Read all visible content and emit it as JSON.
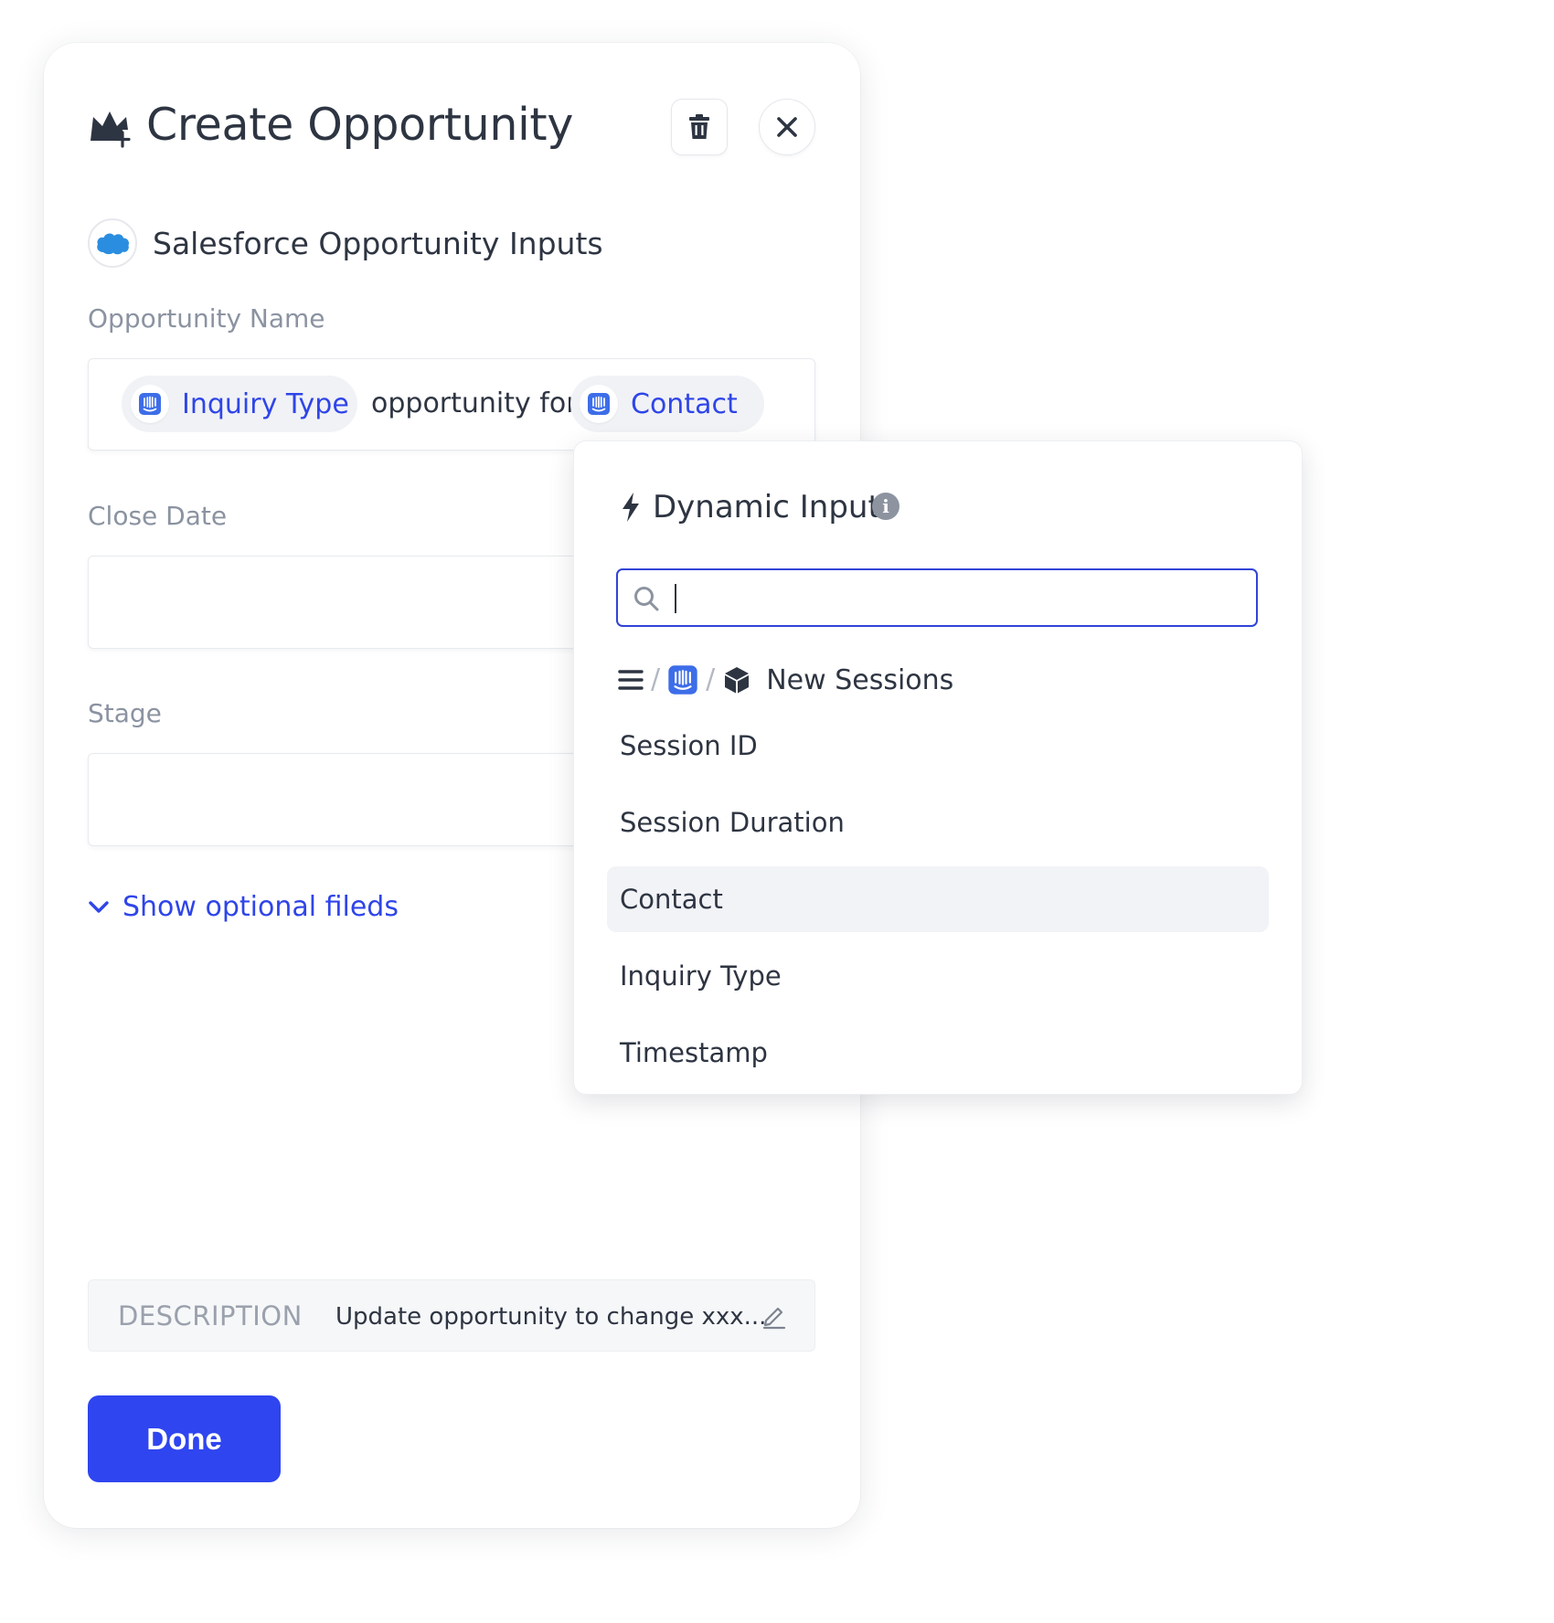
{
  "panel": {
    "title": "Create Opportunity",
    "section_title": "Salesforce Opportunity Inputs",
    "fields": {
      "opportunity_name": {
        "label": "Opportunity Name",
        "tokens": [
          {
            "type": "pill",
            "label": "Inquiry Type",
            "icon": "intercom-icon"
          },
          {
            "type": "text",
            "label": "opportunity for"
          },
          {
            "type": "pill",
            "label": "Contact",
            "icon": "intercom-icon"
          }
        ]
      },
      "close_date": {
        "label": "Close Date",
        "value": ""
      },
      "stage": {
        "label": "Stage",
        "value": ""
      }
    },
    "show_optional_label": "Show optional fileds",
    "description": {
      "label": "DESCRIPTION",
      "text": "Update opportunity to change xxx..."
    },
    "done_label": "Done"
  },
  "dropdown": {
    "title": "Dynamic Input",
    "search_value": "",
    "breadcrumb": {
      "icons": [
        "menu-icon",
        "intercom-icon",
        "cube-icon"
      ],
      "label": "New Sessions"
    },
    "items": [
      "Session ID",
      "Session Duration",
      "Contact",
      "Inquiry Type",
      "Timestamp"
    ],
    "active_item": "Contact"
  },
  "colors": {
    "accent": "#2f45f0",
    "link": "#2f45e8",
    "intercom_blue": "#3d6de8",
    "salesforce_blue": "#2b8de0",
    "muted_label": "#8b93a1",
    "text": "#2e3542"
  }
}
